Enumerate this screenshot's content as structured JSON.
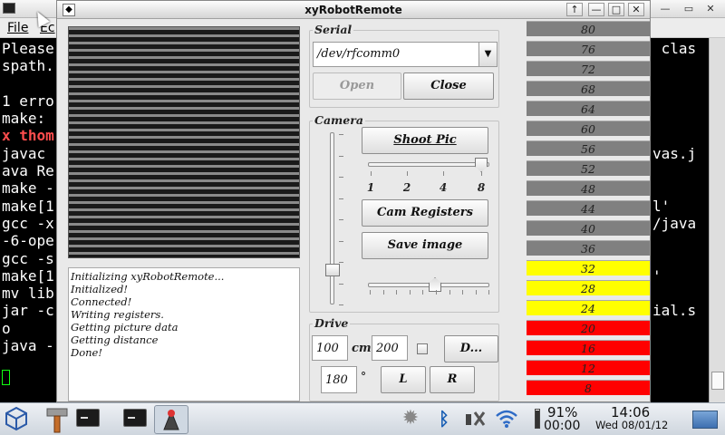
{
  "terminal": {
    "menu": [
      "File",
      "Ec"
    ],
    "left_lines": [
      "Please",
      "spath.",
      "",
      "1 erro",
      "make:",
      "x thom",
      "javac",
      "ava Re",
      "make -",
      "make[1",
      "gcc -x",
      "-6-ope",
      "gcc -s",
      "make[1",
      "mv lib",
      "jar -c",
      "o",
      "java -"
    ],
    "right_lines": [
      " clas",
      "",
      "",
      "",
      "",
      "",
      "vas.j",
      "",
      "",
      "l'",
      "/java",
      "",
      "",
      "'",
      "",
      "ial.s",
      "",
      ""
    ]
  },
  "window": {
    "title": "xyRobotRemote",
    "controls": [
      "↑",
      "—",
      "□",
      "✕"
    ]
  },
  "log": {
    "lines": [
      "Initializing xyRobotRemote...",
      "Initialized!",
      "Connected!",
      "Writing registers.",
      "Getting picture data",
      "Getting distance",
      "Done!"
    ]
  },
  "serial": {
    "title": "Serial",
    "port": "/dev/rfcomm0",
    "open_label": "Open",
    "close_label": "Close"
  },
  "camera": {
    "title": "Camera",
    "shoot_label": "Shoot Pic",
    "registers_label": "Cam Registers",
    "save_label": "Save image",
    "scale_ticks": [
      "1",
      "2",
      "4",
      "8"
    ],
    "scale_value": "8",
    "vertical_slider_level": 0.2,
    "horizontal_slider_level": 0.55
  },
  "drive": {
    "title": "Drive",
    "distance": "100",
    "distance_unit": "cm",
    "speed": "200",
    "angle": "180",
    "angle_unit": "°",
    "d_label": "D...",
    "left_label": "L",
    "right_label": "R"
  },
  "distance_bars": [
    {
      "value": "80",
      "color": "#808080"
    },
    {
      "value": "76",
      "color": "#808080"
    },
    {
      "value": "72",
      "color": "#808080"
    },
    {
      "value": "68",
      "color": "#808080"
    },
    {
      "value": "64",
      "color": "#808080"
    },
    {
      "value": "60",
      "color": "#808080"
    },
    {
      "value": "56",
      "color": "#808080"
    },
    {
      "value": "52",
      "color": "#808080"
    },
    {
      "value": "48",
      "color": "#808080"
    },
    {
      "value": "44",
      "color": "#808080"
    },
    {
      "value": "40",
      "color": "#808080"
    },
    {
      "value": "36",
      "color": "#808080"
    },
    {
      "value": "32",
      "color": "#ffff00"
    },
    {
      "value": "28",
      "color": "#ffff00"
    },
    {
      "value": "24",
      "color": "#ffff00"
    },
    {
      "value": "20",
      "color": "#ff0000"
    },
    {
      "value": "16",
      "color": "#ff0000"
    },
    {
      "value": "12",
      "color": "#ff0000"
    },
    {
      "value": "8",
      "color": "#ff0000"
    }
  ],
  "taskbar": {
    "battery_percent": "91%",
    "battery_time": "00:00",
    "time": "14:06",
    "date": "Wed 08/01/12",
    "icons": [
      "cube-launcher-icon",
      "hammer-icon",
      "terminal-icon",
      "terminal-icon",
      "java-icon",
      "brightness-icon",
      "bluetooth-icon",
      "network-tools-icon",
      "wifi-icon",
      "desktop-icon"
    ]
  }
}
